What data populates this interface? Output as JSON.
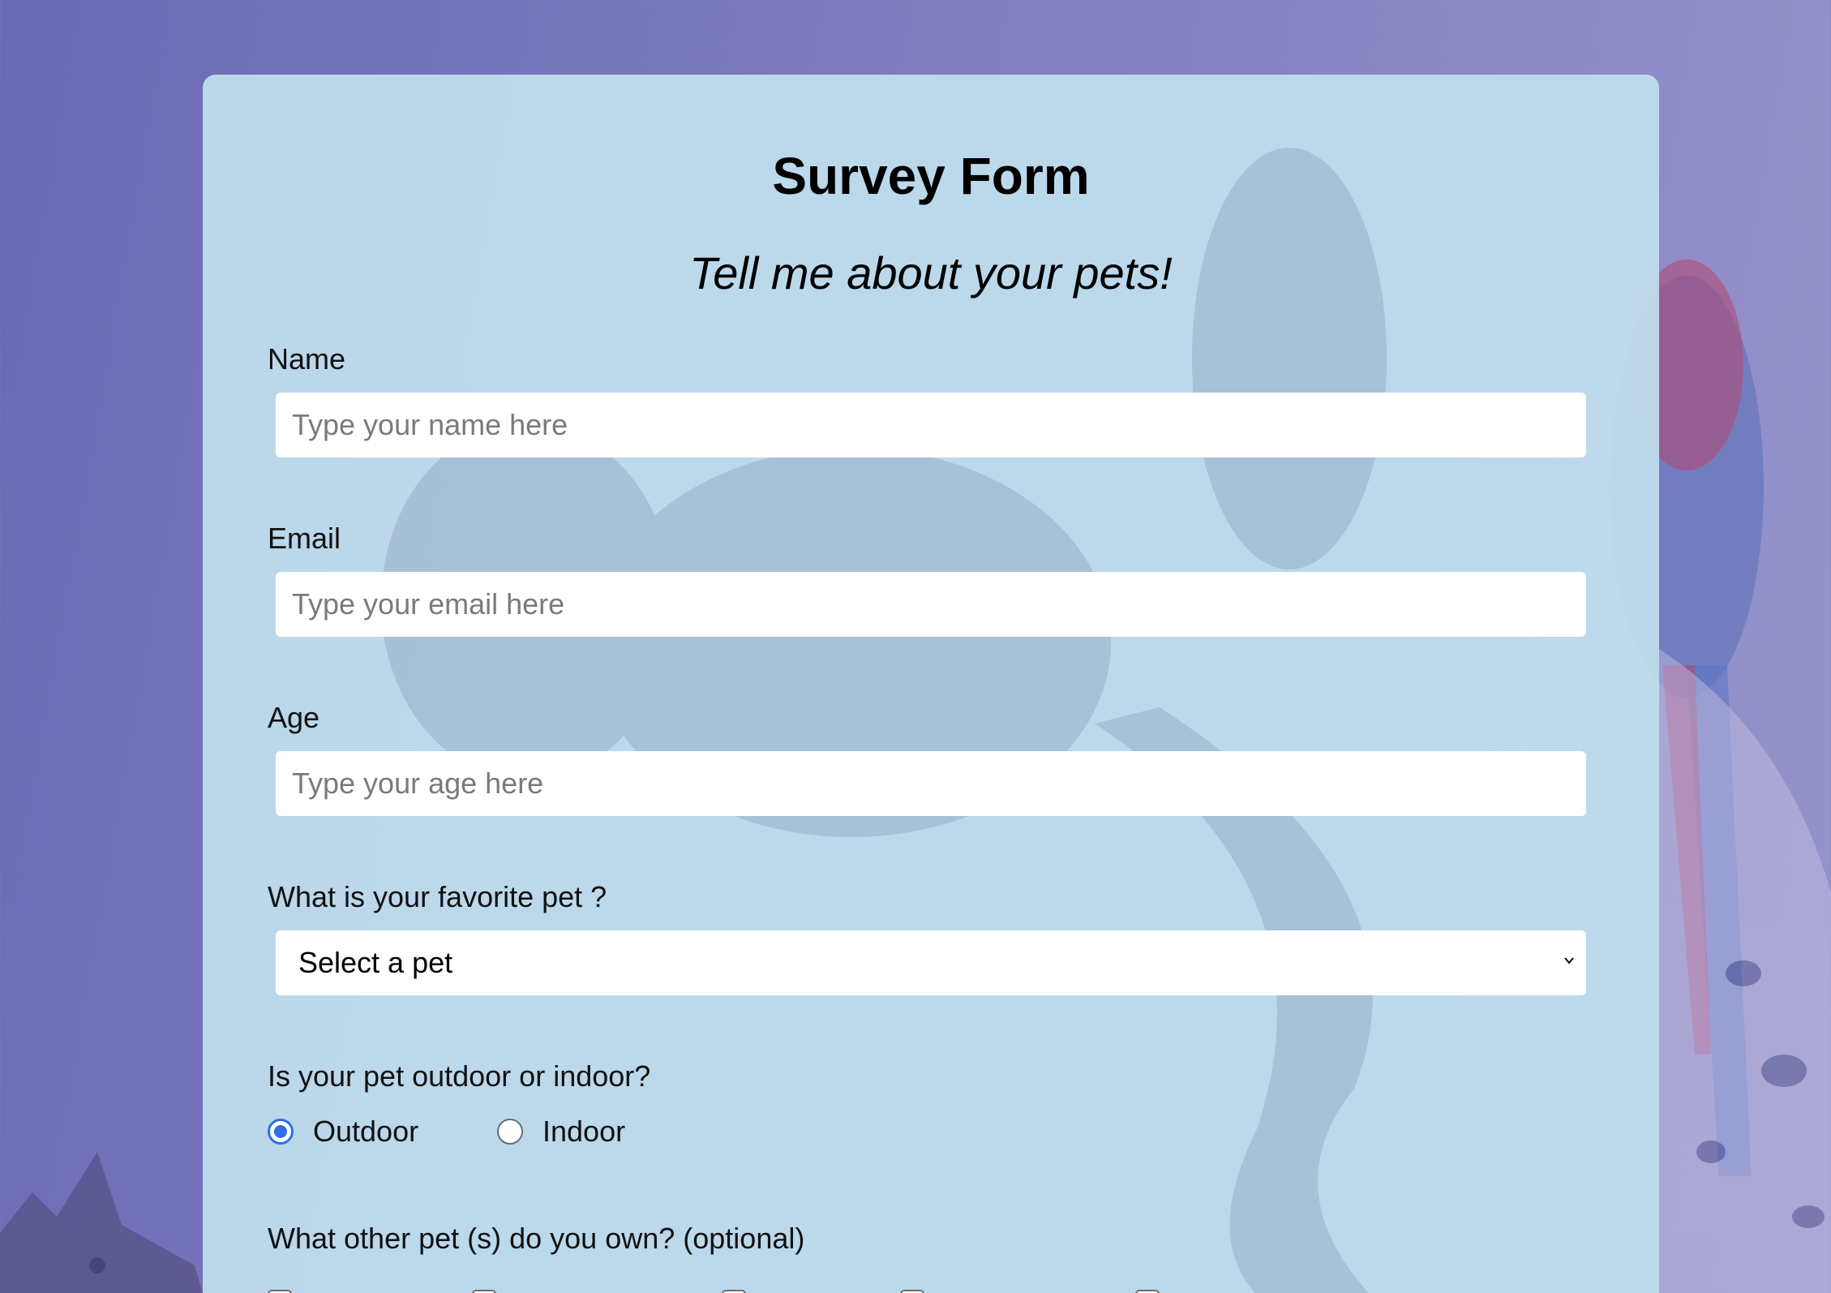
{
  "form": {
    "title": "Survey Form",
    "subtitle": "Tell me about your pets!",
    "name": {
      "label": "Name",
      "placeholder": "Type your name here"
    },
    "email": {
      "label": "Email",
      "placeholder": "Type your email here"
    },
    "age": {
      "label": "Age",
      "placeholder": "Type your age here"
    },
    "favorite_pet": {
      "label": "What is your favorite pet ?",
      "selected": "Select a pet"
    },
    "environment": {
      "question": "Is your pet outdoor or indoor?",
      "options": [
        {
          "label": "Outdoor",
          "checked": true
        },
        {
          "label": "Indoor",
          "checked": false
        }
      ]
    },
    "other_pets": {
      "question": "What other pet (s) do you own? (optional)",
      "checkbox_count": 5
    }
  },
  "colors": {
    "accent": "#2f6ee6",
    "card": "#bedcec",
    "page_background": "#7775bb"
  },
  "icons": {
    "select_arrow": "chevron-down-icon",
    "background": "pet-illustration"
  }
}
